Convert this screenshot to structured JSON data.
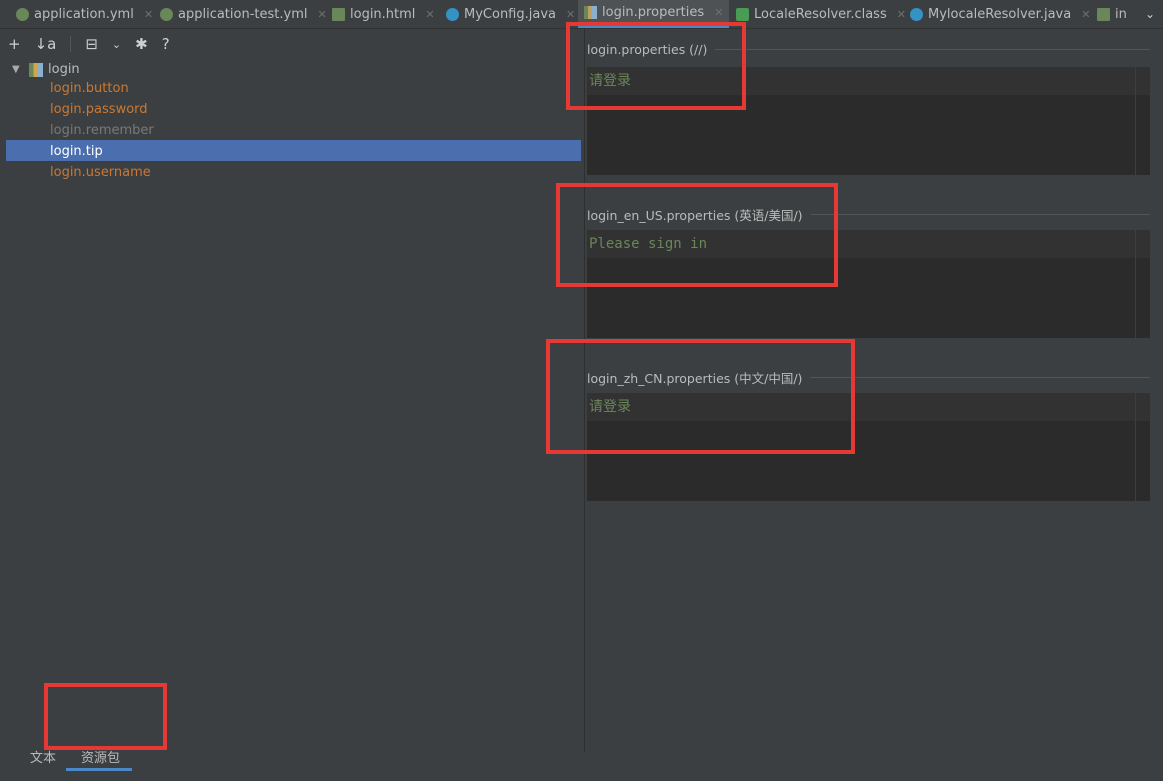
{
  "tabs": [
    {
      "label": "application.yml",
      "icon": "yaml-icon"
    },
    {
      "label": "application-test.yml",
      "icon": "yaml-icon"
    },
    {
      "label": "login.html",
      "icon": "html-icon"
    },
    {
      "label": "MyConfig.java",
      "icon": "java-class-icon"
    },
    {
      "label": "login.properties",
      "icon": "properties-icon",
      "active": true
    },
    {
      "label": "LocaleResolver.class",
      "icon": "class-icon"
    },
    {
      "label": "MylocaleResolver.java",
      "icon": "java-class-icon"
    },
    {
      "label": "in",
      "icon": "html-icon"
    }
  ],
  "tab_overflow": "⌄",
  "toolbar": {
    "add": "+",
    "sort": "↓a",
    "expand": "⊟",
    "dropdown": "⌄",
    "settings": "✱",
    "help": "?"
  },
  "tree": {
    "root": "login",
    "items": [
      {
        "label": "login.button",
        "state": "normal"
      },
      {
        "label": "login.password",
        "state": "normal"
      },
      {
        "label": "login.remember",
        "state": "muted"
      },
      {
        "label": "login.tip",
        "state": "selected"
      },
      {
        "label": "login.username",
        "state": "normal"
      }
    ]
  },
  "bottom_tabs": [
    {
      "label": "文本"
    },
    {
      "label": "资源包",
      "active": true
    }
  ],
  "sections": [
    {
      "title": "login.properties (//)",
      "value": "请登录"
    },
    {
      "title": "login_en_US.properties (英语/美国/)",
      "value": "Please sign in"
    },
    {
      "title": "login_zh_CN.properties (中文/中国/)",
      "value": "请登录"
    }
  ],
  "colors": {
    "background": "#3c3f41",
    "editor": "#2b2b2b",
    "selection": "#4b6eaf",
    "key_text": "#cc7832",
    "value_text": "#6a8759",
    "annotation": "#e53935"
  }
}
